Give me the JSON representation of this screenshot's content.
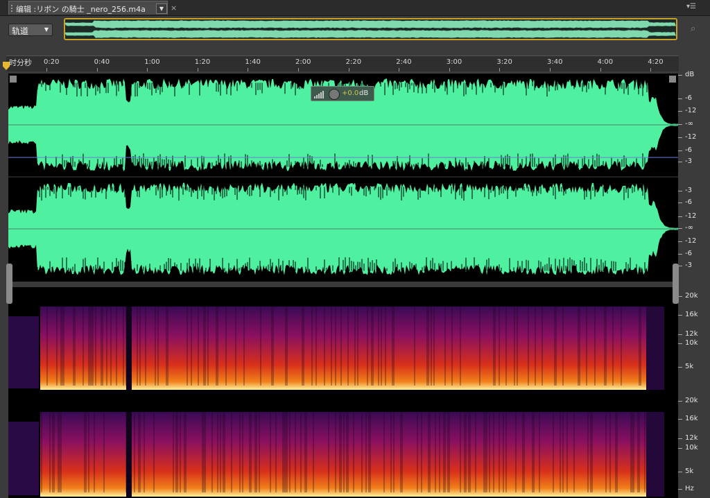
{
  "tab": {
    "title": "编辑 :リボン の騎士 _nero_256.m4a",
    "close": "×",
    "dropdown": "▼"
  },
  "panel_menu": "▾☰",
  "track_select": {
    "value": "轨道",
    "arrow": "▼"
  },
  "ruler": {
    "unit_label": "时分秒",
    "ticks": [
      "0:20",
      "0:40",
      "1:00",
      "1:20",
      "1:40",
      "2:00",
      "2:20",
      "2:40",
      "3:00",
      "3:20",
      "3:40",
      "4:00",
      "4:20"
    ]
  },
  "hud": {
    "value": "+0.0",
    "unit": "dB"
  },
  "db_scale": {
    "unit": "dB",
    "ch1": [
      "-6",
      "-12",
      "-∞",
      "-12",
      "-6",
      "-3"
    ],
    "ch2": [
      "-3",
      "-6",
      "-12",
      "-∞",
      "-12",
      "-6",
      "-3"
    ]
  },
  "freq_scale": {
    "ch1": [
      "20k",
      "16k",
      "12k",
      "10k",
      "5k"
    ],
    "ch2": [
      "20k",
      "16k",
      "12k",
      "10k",
      "5k"
    ],
    "unit": "Hz"
  },
  "colors": {
    "waveform": "#4ff0a0",
    "playhead": "#e8b830",
    "overview_border": "#c9a12a"
  },
  "icons": {
    "zoom": "magnifier-icon",
    "playhead": "playhead-marker-icon"
  }
}
